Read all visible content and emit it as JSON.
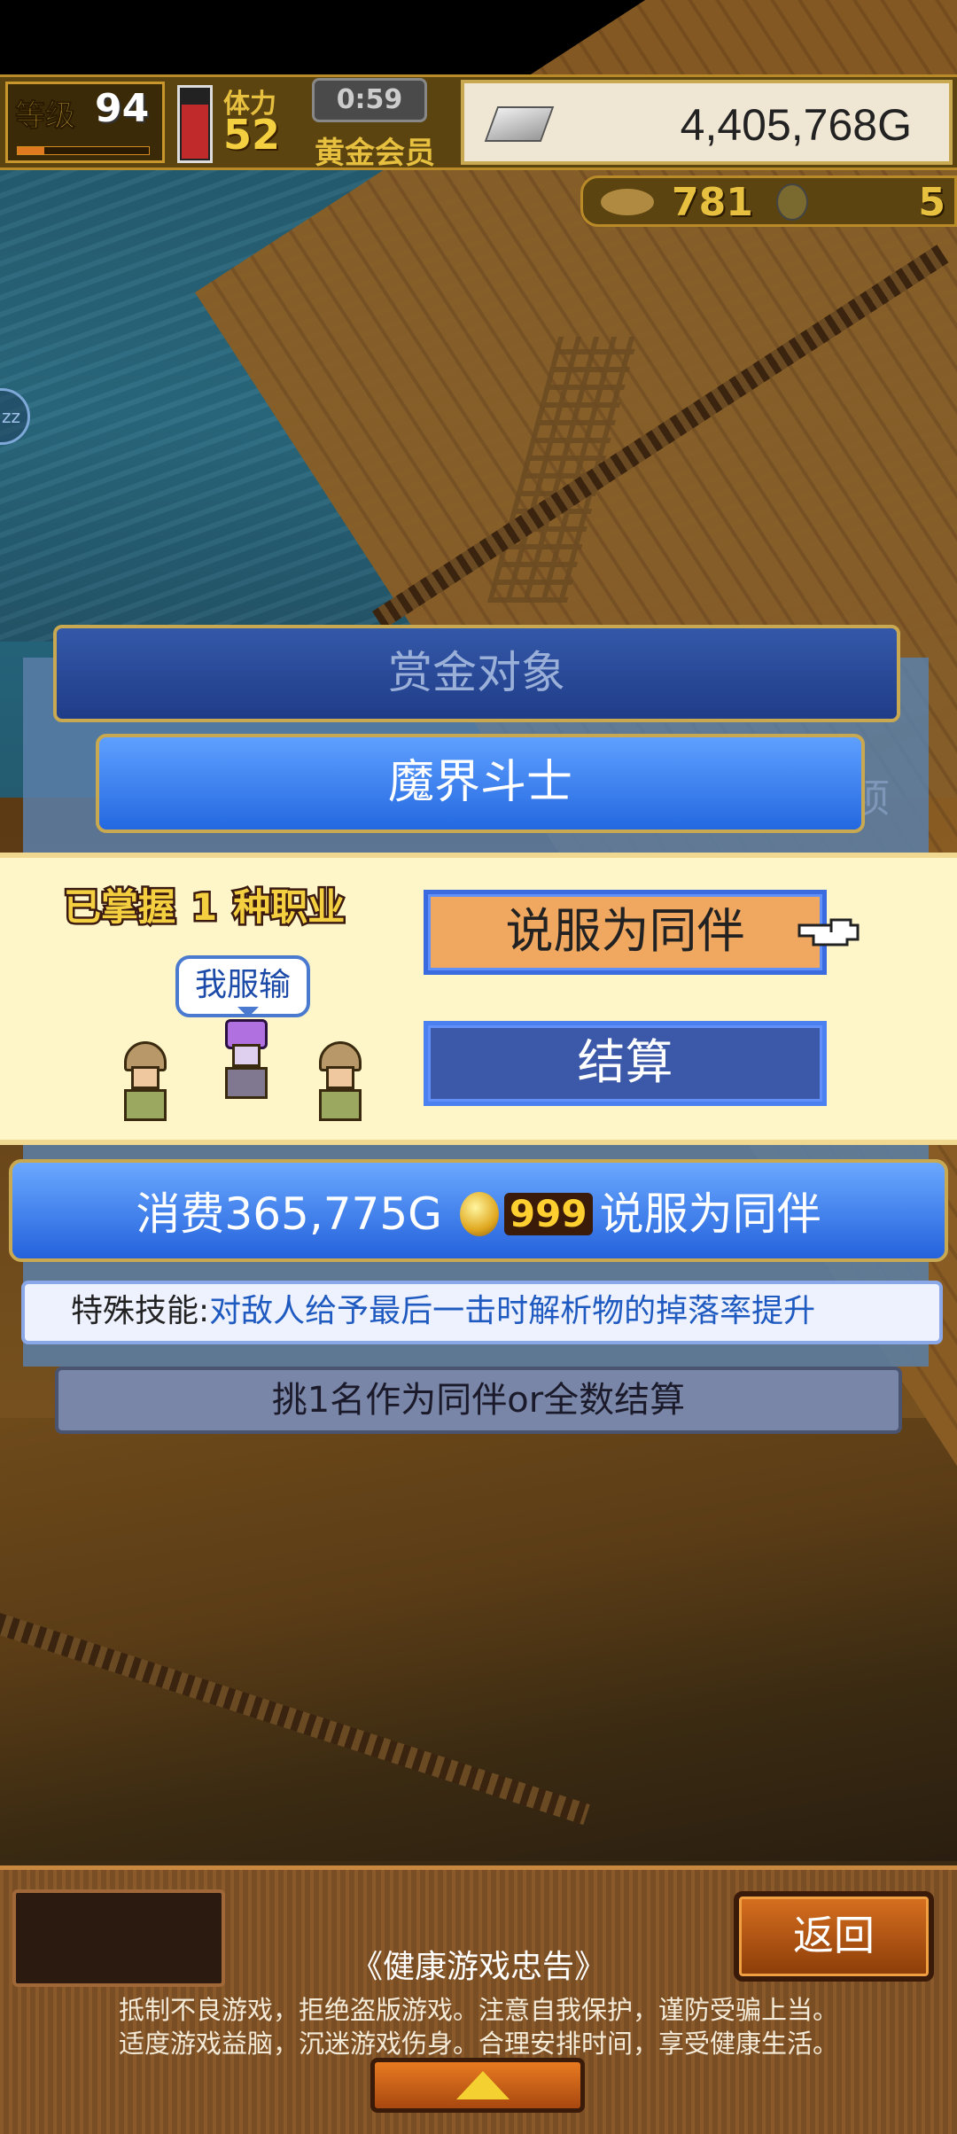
{
  "hud": {
    "level_label": "等级",
    "level": "94",
    "level_progress": 0.2,
    "stamina_label": "体力",
    "stamina": "52",
    "stamina_fill": 0.75,
    "timer": "0:59",
    "membership": "黄金会员",
    "money": "4,405,768G",
    "resource_1": "781",
    "resource_2": "5"
  },
  "bounty": {
    "title": "赏金对象",
    "enemy_name": "魔界斗士",
    "ghost_char": "项"
  },
  "recruit_panel": {
    "mastered_prefix": "已掌握",
    "mastered_count": "1",
    "mastered_suffix": "种职业",
    "speech": "我服输",
    "recruit_button": "说服为同伴",
    "settle_button": "结算"
  },
  "cost": {
    "prefix": "消费365,775G",
    "coin_count": "999",
    "suffix": "说服为同伴"
  },
  "skill": {
    "label": "特殊技能:",
    "desc": "对敌人给予最后一击时解析物的掉落率提升"
  },
  "hint": "挑1名作为同伴or全数结算",
  "bottom": {
    "back_button": "返回",
    "notice_title": "《健康游戏忠告》",
    "notice_line1": "抵制不良游戏，拒绝盗版游戏。注意自我保护，谨防受骗上当。",
    "notice_line2": "适度游戏益脑，沉迷游戏伤身。合理安排时间，享受健康生活。"
  },
  "colors": {
    "accent_blue": "#2468e0",
    "gold_border": "#c8a850",
    "recruit_orange": "#f0a860"
  }
}
